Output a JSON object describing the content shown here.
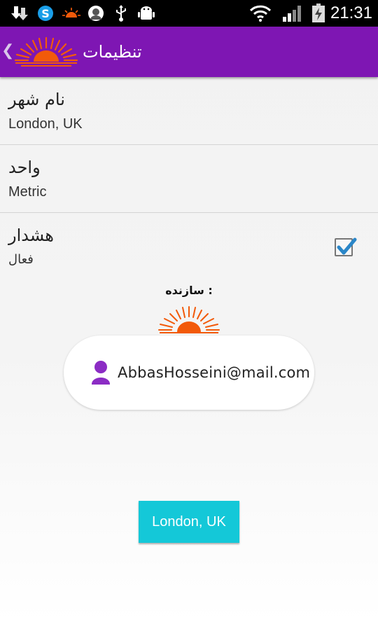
{
  "status_bar": {
    "time": "21:31",
    "icons": [
      "download-icon",
      "skype-icon",
      "app-logo-icon",
      "avatar-icon",
      "usb-icon",
      "android-debug-icon",
      "wifi-icon",
      "signal-icon",
      "battery-charging-icon"
    ]
  },
  "action_bar": {
    "title": "تنظیمات",
    "back_icon": "chevron-left-icon",
    "logo": "sunrise-logo"
  },
  "preferences": [
    {
      "title": "نام شهر",
      "summary": "London, UK"
    },
    {
      "title": "واحد",
      "summary": "Metric"
    },
    {
      "title": "هشدار",
      "summary": "فعال",
      "checked": true
    }
  ],
  "developer": {
    "label": "سازنده :",
    "email": "AbbasHosseini@mail.com"
  },
  "city_button": {
    "label": "London, UK"
  },
  "colors": {
    "action_bar": "#7e16b3",
    "accent_button": "#14c8d8",
    "person_icon": "#8b2cc4",
    "logo_orange": "#f25a0a",
    "checkbox_check": "#2a86c8"
  }
}
